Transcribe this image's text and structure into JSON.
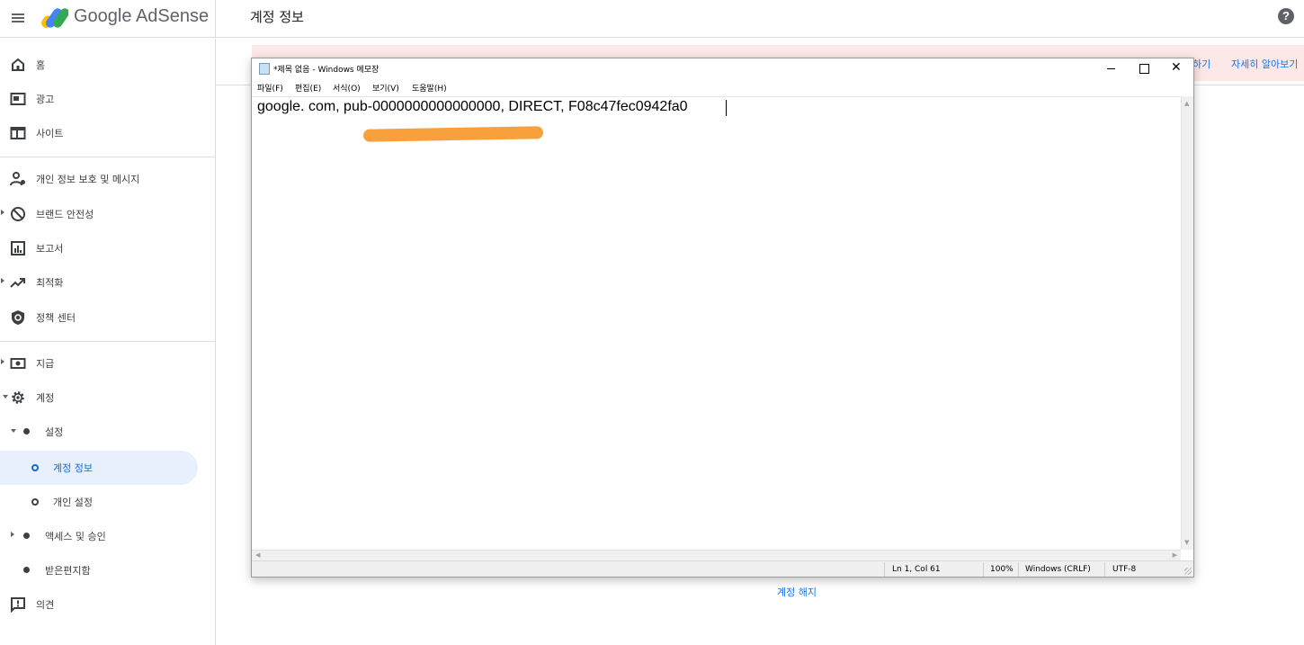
{
  "header": {
    "brand": "Google AdSense",
    "page_title": "계정 정보",
    "help": "?"
  },
  "sidebar": {
    "items": [
      {
        "label": "홈",
        "icon": "home-icon"
      },
      {
        "label": "광고",
        "icon": "ads-icon"
      },
      {
        "label": "사이트",
        "icon": "sites-icon"
      },
      {
        "label": "개인 정보 보호 및 메시지",
        "icon": "privacy-icon"
      },
      {
        "label": "브랜드 안전성",
        "icon": "block-icon"
      },
      {
        "label": "보고서",
        "icon": "reports-icon"
      },
      {
        "label": "최적화",
        "icon": "trending-icon"
      },
      {
        "label": "정책 센터",
        "icon": "shield-icon"
      },
      {
        "label": "지급",
        "icon": "payments-icon"
      },
      {
        "label": "계정",
        "icon": "gear-icon"
      },
      {
        "label": "설정"
      },
      {
        "label": "계정 정보"
      },
      {
        "label": "개인 설정"
      },
      {
        "label": "액세스 및 승인"
      },
      {
        "label": "받은편지함"
      },
      {
        "label": "의견",
        "icon": "feedback-icon"
      }
    ]
  },
  "main": {
    "banner_links": [
      "하기",
      "자세히 알아보기"
    ],
    "close_account": "계정 해지"
  },
  "notepad": {
    "title": "*제목 없음 - Windows 메모장",
    "menus": [
      "파일(F)",
      "편집(E)",
      "서식(O)",
      "보기(V)",
      "도움말(H)"
    ],
    "content": "google. com, pub-0000000000000000, DIRECT, F08c47fec0942fa0",
    "status": {
      "position": "Ln 1, Col 61",
      "zoom": "100%",
      "line_ending": "Windows (CRLF)",
      "encoding": "UTF-8"
    },
    "redaction_color": "#f7a03c"
  },
  "colors": {
    "accent": "#1a73e8",
    "active_bg": "#e8f0fe",
    "banner_bg": "#fce8e6"
  }
}
